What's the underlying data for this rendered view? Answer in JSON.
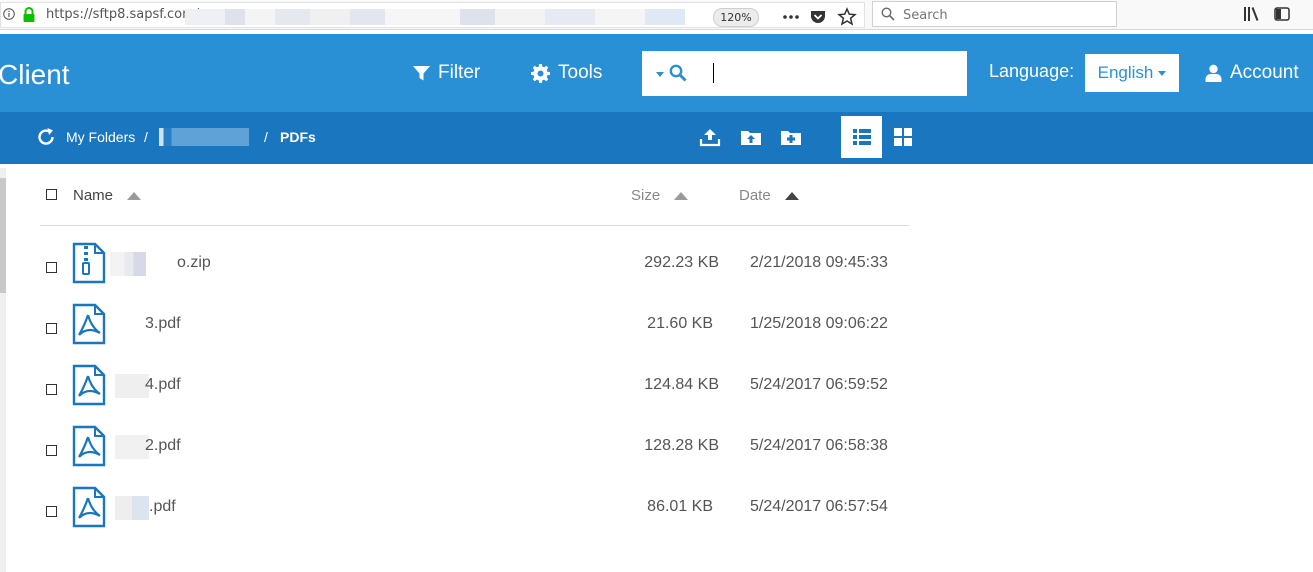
{
  "browser": {
    "url": "https://sftp8.sapsf.com/",
    "zoom": "120%",
    "search_placeholder": "Search"
  },
  "header": {
    "brand": "Client",
    "filter_label": "Filter",
    "tools_label": "Tools",
    "search_value": "",
    "language_label": "Language:",
    "language_value": "English",
    "account_label": "Account"
  },
  "breadcrumb": {
    "root": "My Folders",
    "sep": "/",
    "current": "PDFs"
  },
  "list": {
    "columns": {
      "name": "Name",
      "size": "Size",
      "date": "Date"
    },
    "files": [
      {
        "name_suffix": "o.zip",
        "size": "292.23 KB",
        "date": "2/21/2018 09:45:33",
        "type": "zip"
      },
      {
        "name_suffix": "3.pdf",
        "size": "21.60 KB",
        "date": "1/25/2018 09:06:22",
        "type": "pdf"
      },
      {
        "name_suffix": "4.pdf",
        "size": "124.84 KB",
        "date": "5/24/2017 06:59:52",
        "type": "pdf"
      },
      {
        "name_suffix": "2.pdf",
        "size": "128.28 KB",
        "date": "5/24/2017 06:58:38",
        "type": "pdf"
      },
      {
        "name_suffix": ".pdf",
        "size": "86.01 KB",
        "date": "5/24/2017 06:57:54",
        "type": "pdf"
      }
    ]
  },
  "colors": {
    "header_bg": "#2a90d5",
    "crumb_bg": "#1a76be",
    "icon_blue": "#1a76be"
  },
  "icons": [
    "info-icon",
    "lock-icon",
    "dots-icon",
    "pocket-icon",
    "star-icon",
    "library-icon",
    "sidebar-icon",
    "filter-icon",
    "gear-icon",
    "search-icon",
    "user-icon",
    "refresh-icon",
    "upload-icon",
    "upload-folder-icon",
    "new-folder-icon",
    "list-view-icon",
    "grid-view-icon",
    "zip-file-icon",
    "pdf-file-icon"
  ]
}
